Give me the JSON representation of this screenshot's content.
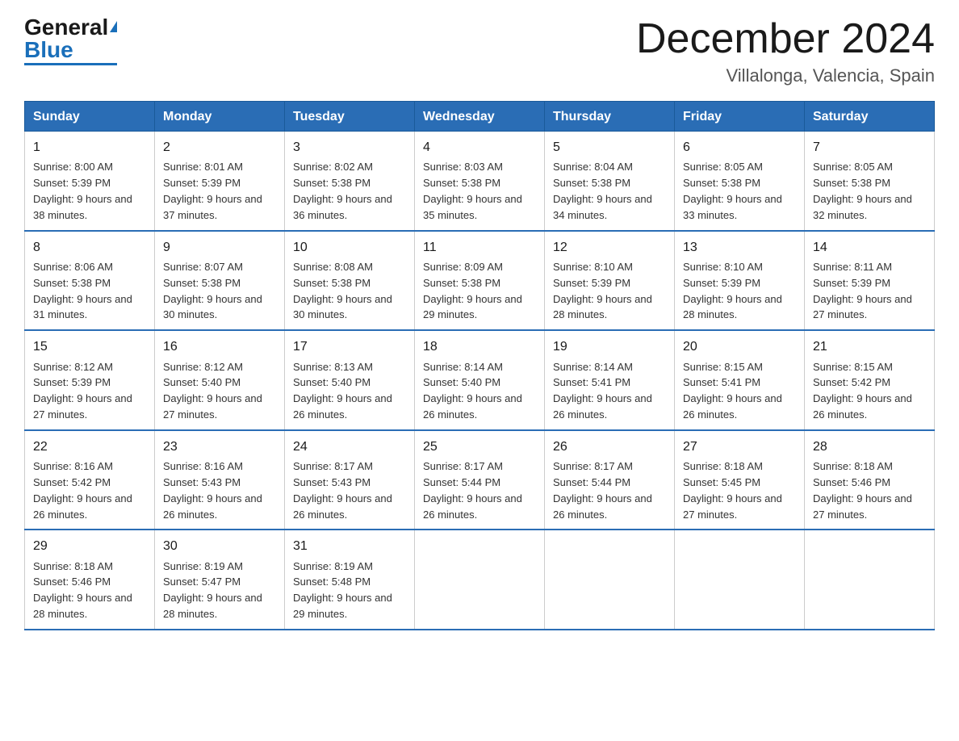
{
  "logo": {
    "general": "General",
    "blue": "Blue"
  },
  "title": "December 2024",
  "subtitle": "Villalonga, Valencia, Spain",
  "days_of_week": [
    "Sunday",
    "Monday",
    "Tuesday",
    "Wednesday",
    "Thursday",
    "Friday",
    "Saturday"
  ],
  "weeks": [
    [
      {
        "day": "1",
        "sunrise": "8:00 AM",
        "sunset": "5:39 PM",
        "daylight": "9 hours and 38 minutes."
      },
      {
        "day": "2",
        "sunrise": "8:01 AM",
        "sunset": "5:39 PM",
        "daylight": "9 hours and 37 minutes."
      },
      {
        "day": "3",
        "sunrise": "8:02 AM",
        "sunset": "5:38 PM",
        "daylight": "9 hours and 36 minutes."
      },
      {
        "day": "4",
        "sunrise": "8:03 AM",
        "sunset": "5:38 PM",
        "daylight": "9 hours and 35 minutes."
      },
      {
        "day": "5",
        "sunrise": "8:04 AM",
        "sunset": "5:38 PM",
        "daylight": "9 hours and 34 minutes."
      },
      {
        "day": "6",
        "sunrise": "8:05 AM",
        "sunset": "5:38 PM",
        "daylight": "9 hours and 33 minutes."
      },
      {
        "day": "7",
        "sunrise": "8:05 AM",
        "sunset": "5:38 PM",
        "daylight": "9 hours and 32 minutes."
      }
    ],
    [
      {
        "day": "8",
        "sunrise": "8:06 AM",
        "sunset": "5:38 PM",
        "daylight": "9 hours and 31 minutes."
      },
      {
        "day": "9",
        "sunrise": "8:07 AM",
        "sunset": "5:38 PM",
        "daylight": "9 hours and 30 minutes."
      },
      {
        "day": "10",
        "sunrise": "8:08 AM",
        "sunset": "5:38 PM",
        "daylight": "9 hours and 30 minutes."
      },
      {
        "day": "11",
        "sunrise": "8:09 AM",
        "sunset": "5:38 PM",
        "daylight": "9 hours and 29 minutes."
      },
      {
        "day": "12",
        "sunrise": "8:10 AM",
        "sunset": "5:39 PM",
        "daylight": "9 hours and 28 minutes."
      },
      {
        "day": "13",
        "sunrise": "8:10 AM",
        "sunset": "5:39 PM",
        "daylight": "9 hours and 28 minutes."
      },
      {
        "day": "14",
        "sunrise": "8:11 AM",
        "sunset": "5:39 PM",
        "daylight": "9 hours and 27 minutes."
      }
    ],
    [
      {
        "day": "15",
        "sunrise": "8:12 AM",
        "sunset": "5:39 PM",
        "daylight": "9 hours and 27 minutes."
      },
      {
        "day": "16",
        "sunrise": "8:12 AM",
        "sunset": "5:40 PM",
        "daylight": "9 hours and 27 minutes."
      },
      {
        "day": "17",
        "sunrise": "8:13 AM",
        "sunset": "5:40 PM",
        "daylight": "9 hours and 26 minutes."
      },
      {
        "day": "18",
        "sunrise": "8:14 AM",
        "sunset": "5:40 PM",
        "daylight": "9 hours and 26 minutes."
      },
      {
        "day": "19",
        "sunrise": "8:14 AM",
        "sunset": "5:41 PM",
        "daylight": "9 hours and 26 minutes."
      },
      {
        "day": "20",
        "sunrise": "8:15 AM",
        "sunset": "5:41 PM",
        "daylight": "9 hours and 26 minutes."
      },
      {
        "day": "21",
        "sunrise": "8:15 AM",
        "sunset": "5:42 PM",
        "daylight": "9 hours and 26 minutes."
      }
    ],
    [
      {
        "day": "22",
        "sunrise": "8:16 AM",
        "sunset": "5:42 PM",
        "daylight": "9 hours and 26 minutes."
      },
      {
        "day": "23",
        "sunrise": "8:16 AM",
        "sunset": "5:43 PM",
        "daylight": "9 hours and 26 minutes."
      },
      {
        "day": "24",
        "sunrise": "8:17 AM",
        "sunset": "5:43 PM",
        "daylight": "9 hours and 26 minutes."
      },
      {
        "day": "25",
        "sunrise": "8:17 AM",
        "sunset": "5:44 PM",
        "daylight": "9 hours and 26 minutes."
      },
      {
        "day": "26",
        "sunrise": "8:17 AM",
        "sunset": "5:44 PM",
        "daylight": "9 hours and 26 minutes."
      },
      {
        "day": "27",
        "sunrise": "8:18 AM",
        "sunset": "5:45 PM",
        "daylight": "9 hours and 27 minutes."
      },
      {
        "day": "28",
        "sunrise": "8:18 AM",
        "sunset": "5:46 PM",
        "daylight": "9 hours and 27 minutes."
      }
    ],
    [
      {
        "day": "29",
        "sunrise": "8:18 AM",
        "sunset": "5:46 PM",
        "daylight": "9 hours and 28 minutes."
      },
      {
        "day": "30",
        "sunrise": "8:19 AM",
        "sunset": "5:47 PM",
        "daylight": "9 hours and 28 minutes."
      },
      {
        "day": "31",
        "sunrise": "8:19 AM",
        "sunset": "5:48 PM",
        "daylight": "9 hours and 29 minutes."
      },
      null,
      null,
      null,
      null
    ]
  ]
}
